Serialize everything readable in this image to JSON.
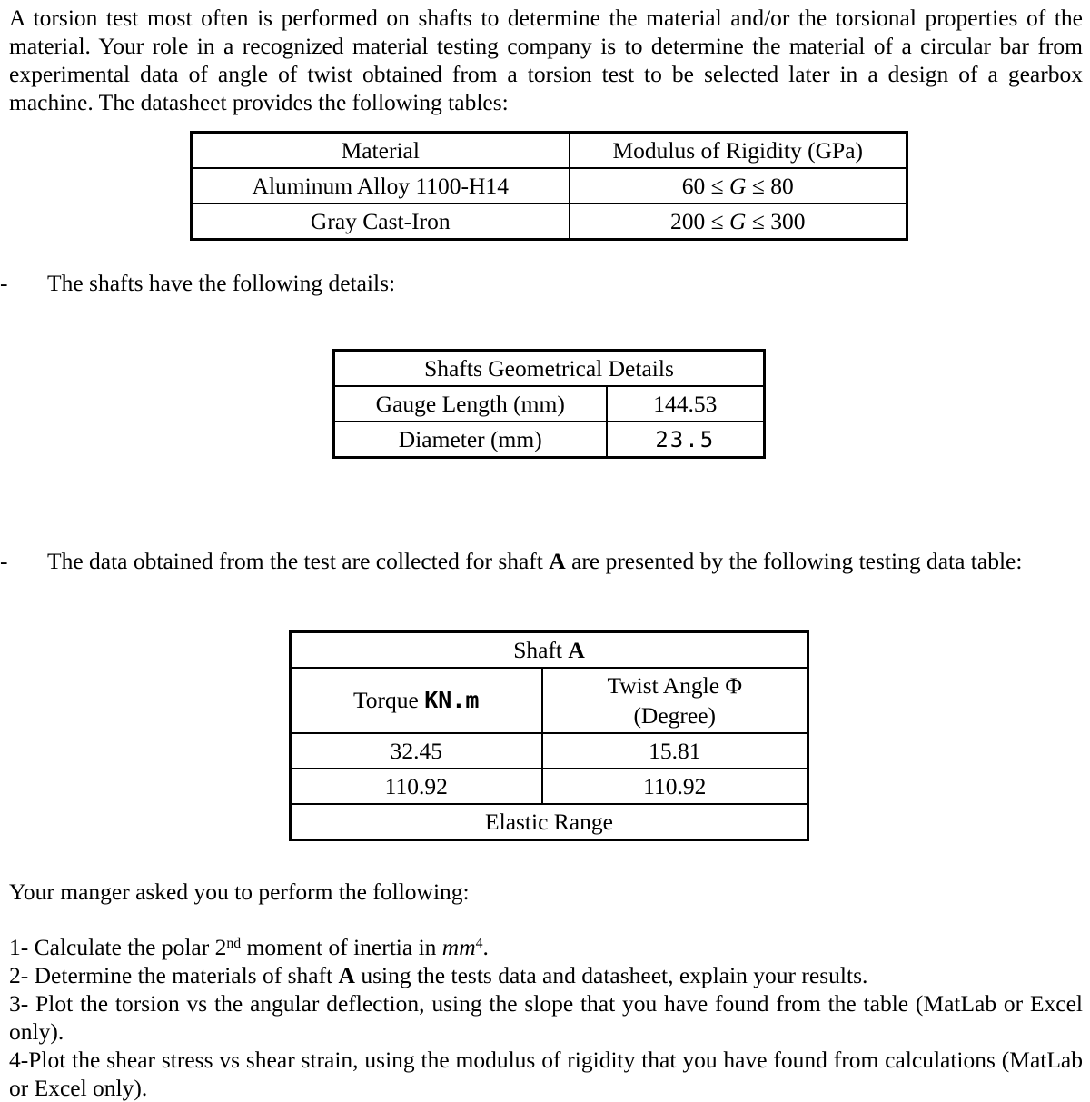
{
  "document": {
    "intro_paragraph": "A torsion test most often is performed on shafts to determine the material and/or the torsional properties of the material. Your role in a recognized material testing company is to determine the material of a circular bar from experimental data of angle of twist obtained from a torsion test to be selected later in a design of a gearbox machine. The datasheet provides the following tables:",
    "bullet_marker": "-",
    "bullet_shafts": "The shafts have the following details:",
    "bullet_data": "The data obtained from the test are collected for shaft A are presented by the following testing data table:",
    "bullet_data_pre": "The data obtained from the test are collected for shaft ",
    "bullet_data_bold": "A",
    "bullet_data_post": " are presented by the following testing data table:",
    "tasks_intro": "Your manger asked you to perform the following:"
  },
  "materials_table": {
    "headers": [
      "Material",
      "Modulus of Rigidity (GPa)"
    ],
    "rows": [
      {
        "material": "Aluminum Alloy 1100-H14",
        "g_low": "60",
        "g_sym": "G",
        "g_high": "80",
        "rel": "≤",
        "modulus_text": "60 ≤ G ≤ 80"
      },
      {
        "material": "Gray Cast-Iron",
        "g_low": "200",
        "g_sym": "G",
        "g_high": "300",
        "rel": "≤",
        "modulus_text": "200 ≤ G ≤ 300"
      }
    ]
  },
  "geometry_table": {
    "title": "Shafts Geometrical Details",
    "rows": [
      {
        "label": "Gauge Length (mm)",
        "value": "144.53"
      },
      {
        "label": "Diameter (mm)",
        "value": "23.5"
      }
    ]
  },
  "shaft_a_table": {
    "title_pre": "Shaft ",
    "title_bold": "A",
    "title": "Shaft A",
    "col1_label": "Torque ",
    "col1_unit": "KN.m",
    "col2_line1": "Twist Angle Φ",
    "col2_line2": "(Degree)",
    "rows": [
      {
        "torque": "32.45",
        "twist_angle": "15.81"
      },
      {
        "torque": "110.92",
        "twist_angle": "110.92"
      }
    ],
    "footer": "Elastic Range"
  },
  "tasks": [
    {
      "number": "1- ",
      "pre": "Calculate the polar 2",
      "sup1": "nd",
      "mid": " moment of inertia in ",
      "unit": "mm",
      "sup2": "4",
      "post": ".",
      "full_text": "1- Calculate the polar 2nd moment of inertia in mm4."
    },
    {
      "number": "2- ",
      "pre": "Determine the materials of shaft ",
      "bold": "A",
      "post": " using the tests data and datasheet, explain your results.",
      "full_text": "2- Determine the materials of shaft A using the tests data and datasheet, explain your results."
    },
    {
      "number": "3- ",
      "text": "Plot the torsion vs the angular deflection, using the slope that you have found from the table (MatLab or Excel only).",
      "full_text": "3- Plot the torsion vs the angular deflection, using the slope that you have found from the table (MatLab or Excel only)."
    },
    {
      "number": "4-",
      "text": "Plot the shear stress vs shear strain, using the modulus of rigidity that you have found from calculations (MatLab or Excel only).",
      "full_text": "4-Plot the shear stress vs shear strain, using the modulus of rigidity that you have found from calculations (MatLab or Excel only)."
    }
  ],
  "colors": {
    "header_dark": "#c0c0c0",
    "header_light": "#f1f1f1",
    "row_shade": "#d9d9d9",
    "border": "#000000",
    "text": "#000000",
    "background": "#ffffff"
  }
}
